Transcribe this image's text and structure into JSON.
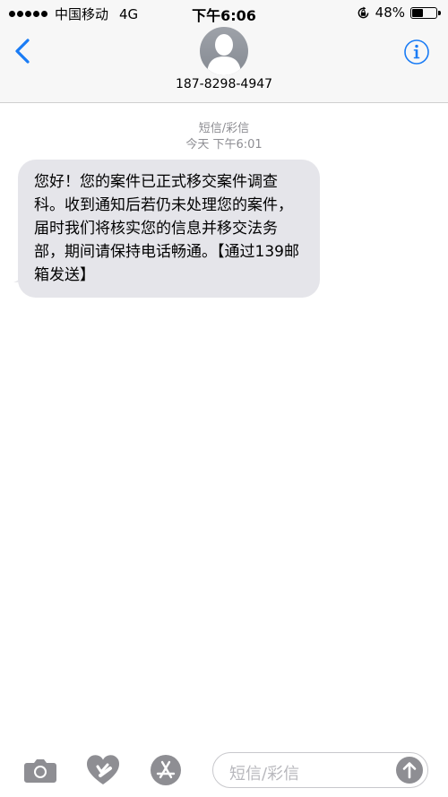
{
  "status_bar": {
    "carrier": "中国移动",
    "network": "4G",
    "time": "下午6:06",
    "battery_text": "48%",
    "battery_level": 0.48
  },
  "header": {
    "back_icon": "chevron-left-icon",
    "avatar_icon": "person-silhouette-icon",
    "contact": "187-8298-4947",
    "info_icon": "info-icon"
  },
  "conversation": {
    "message_type": "短信/彩信",
    "timestamp": "今天 下午6:01",
    "messages": [
      {
        "direction": "incoming",
        "text": "您好！您的案件已正式移交案件调查科。收到通知后若仍未处理您的案件，届时我们将核实您的信息并移交法务部，期间请保持电话畅通。【通过139邮箱发送】"
      }
    ]
  },
  "input_bar": {
    "placeholder": "短信/彩信",
    "icons": [
      "camera-icon",
      "digital-touch-heart-icon",
      "app-store-icon",
      "send-arrow-icon"
    ]
  },
  "colors": {
    "accent": "#1a7cf5",
    "bubble_incoming": "#e5e5ea",
    "header_bg": "#f7f7f7",
    "timestamp_gray": "#8e8e93"
  }
}
